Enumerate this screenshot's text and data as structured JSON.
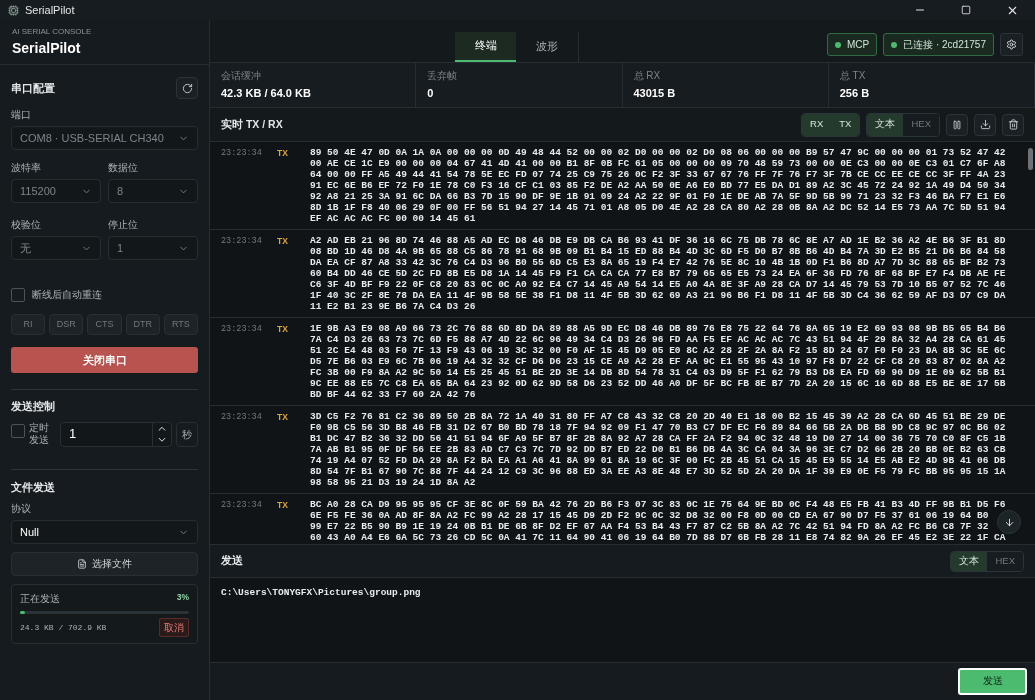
{
  "window": {
    "title": "SerialPilot"
  },
  "sidebar": {
    "subtitle": "AI SERIAL CONSOLE",
    "title": "SerialPilot",
    "port_config": {
      "heading": "串口配置",
      "port": {
        "label": "端口",
        "value": "COM8 · USB-SERIAL CH340",
        "disabled": true
      },
      "fields": [
        {
          "label": "波特率",
          "value": "115200",
          "disabled": true
        },
        {
          "label": "数据位",
          "value": "8",
          "disabled": true
        },
        {
          "label": "校验位",
          "value": "无",
          "disabled": true
        },
        {
          "label": "停止位",
          "value": "1",
          "disabled": true
        }
      ],
      "auto_reconnect": {
        "label": "断线后自动重连",
        "checked": false
      },
      "signals": [
        {
          "label": "RI",
          "on": false
        },
        {
          "label": "DSR",
          "on": false
        },
        {
          "label": "CTS",
          "on": false
        },
        {
          "label": "DTR",
          "on": false
        },
        {
          "label": "RTS",
          "on": false
        }
      ],
      "close_button": "关闭串口"
    },
    "send_control": {
      "heading": "发送控制",
      "timed": {
        "label": "定时发送",
        "checked": false
      },
      "interval": "1",
      "unit": "秒"
    },
    "file_send": {
      "heading": "文件发送",
      "protocol": {
        "label": "协议",
        "value": "Null"
      },
      "choose_button": "选择文件",
      "progress": {
        "label": "正在发送",
        "percent": "3%",
        "level": 0.03,
        "size": "24.3 KB / 702.9 KB",
        "cancel": "取消"
      }
    }
  },
  "tabs": [
    {
      "label": "终端",
      "selected": true
    },
    {
      "label": "波形",
      "selected": false
    }
  ],
  "badges": [
    {
      "label": "MCP"
    },
    {
      "label": "已连接 · 2cd21757"
    }
  ],
  "stats": [
    {
      "label": "会话缓冲",
      "value": "42.3 KB / 64.0 KB"
    },
    {
      "label": "丢弃帧",
      "value": "0"
    },
    {
      "label": "总 RX",
      "value": "43015 B"
    },
    {
      "label": "总 TX",
      "value": "256 B"
    }
  ],
  "log": {
    "title": "实时 TX / RX",
    "filters": [
      {
        "label": "RX",
        "on": true
      },
      {
        "label": "TX",
        "on": true
      }
    ],
    "modes": [
      {
        "label": "文本",
        "selected": true
      },
      {
        "label": "HEX",
        "selected": false
      }
    ],
    "entries": [
      {
        "time": "23:23:34",
        "direction": "TX",
        "lines": [
          "89 50 4E 47 0D 0A 1A 0A 00 00 00 0D 49 48 44 52 00 00 02 D0 00 00 02 D0 08 06 00 00 00 B9 57 47 9C 00 00 00 01 73 52 47 42",
          "00 AE CE 1C E9 00 00 00 04 67 41 4D 41 00 00 B1 8F 0B FC 61 05 00 00 00 09 70 48 59 73 00 00 0E C3 00 00 0E C3 01 C7 6F A8",
          "64 00 00 FF A5 49 44 41 54 78 5E EC FD 07 74 25 C9 75 26 0C F2 3F 33 67 67 76 FF 7F 76 F7 3F 7B CE CC EE CE CC 3F FF 4A 23",
          "91 EC 6E B6 EF 72 F0 1E 78 C0 F3 16 CF C1 03 85 F2 DE A2 AA 50 0E A6 E0 BD 77 E5 DA D1 89 A2 3C 45 72 24 92 1A 49 D4 50 34",
          "92 A8 21 25 3A 91 6C DA 66 B3 7D 15 90 DF 9E 1B 91 09 24 A2 22 9F 01 F0 1E DE AB 7A 5F 9D 5B 99 71 23 32 F3 46 BA F7 E1 E6",
          "8D 1B 1F F8 40 06 29 0F 00 FF 56 51 94 27 14 45 71 01 A8 05 D0 4E A2 28 CA 80 A2 28 0B 8A A2 DC 52 14 E5 73 AA 7C 5D 51 94",
          "EF AC AC AC FC 00 00 14 45 61"
        ]
      },
      {
        "time": "23:23:34",
        "direction": "TX",
        "lines": [
          "A2 AD EB 21 96 8D 74 46 88 A5 AD EC D8 46 DB E9 DB CA B6 93 41 DF 36 16 6C 75 DB 78 6C 8E A7 AD 1E B2 36 A2 4E B6 3F B1 8D",
          "08 BD 1D 46 D8 4A 9B 65 88 C5 86 78 91 68 9B 09 B1 B4 15 ED 88 B4 4D 3C 6D F5 D0 B7 8B B6 4D B4 7A 3D E2 B5 21 D6 B6 84 58",
          "DA EA CF 87 A8 33 42 3C 76 C4 D3 96 B0 55 6D C5 E3 8A 65 19 F4 E7 42 76 5E 8C 10 4B 1B 0D F1 B6 8D A7 7D 3C 88 65 BF B2 73",
          "60 B4 DD 46 CE 5D 2C FD 8B E5 D8 1A 14 45 F9 F1 CA CA CA 77 E8 B7 79 65 65 E5 73 24 EA 6F 36 FD 76 8F 68 BF E7 F4 DB AE FE",
          "C6 3F 4D BF F9 22 0F C8 20 83 0C 0C A0 92 E4 C7 14 45 A9 54 14 E5 A0 4A 8E 3F A9 28 CA D7 14 45 79 53 7D 10 B5 07 52 7C 46",
          "1F 40 3C 2F 8E 78 DA EA 11 4F 9B 58 5E 38 F1 D8 11 4F 5B 3D 62 69 A3 21 96 B6 F1 D8 11 4F 5B 3D C4 36 62 59 AF D3 D7 C9 DA",
          "11 E2 B1 23 9E B6 7A C4 D3 26"
        ]
      },
      {
        "time": "23:23:34",
        "direction": "TX",
        "lines": [
          "1E 9B A3 E9 08 A9 66 73 2C 76 88 6D 8D DA 89 88 A5 9D EC D8 46 DB 89 76 E8 75 22 64 76 8A 65 19 E2 69 93 08 9B B5 65 B4 B6",
          "7A C4 D3 26 63 73 7C 6D F5 88 A7 4D 22 6C 96 49 34 C4 D3 26 96 FD AA F5 EF AC AC AC 7C 43 51 94 4F 29 8A 32 A4 28 CA 61 45",
          "51 2C E4 48 03 F0 7F 13 F9 43 06 19 3C 32 00 F0 AF 15 45 D9 05 E0 8C A2 28 2F 2A 8A F2 15 8D 24 67 F0 F0 23 DA 8B 3C 5E 6C",
          "D5 7E B6 03 E9 6C 7B 06 19 A4 32 32 CF D6 D6 23 15 CE A9 A2 28 EF AA 9C E1 55 95 43 10 97 F8 D7 22 CF C8 20 83 87 02 8A A2",
          "FC 3B 00 F9 8A A2 9C 50 14 E5 25 45 51 BE 2D 3E 14 DB 8D 54 78 31 C4 03 D9 5F F1 62 79 B3 D8 EA FD 69 90 D9 1E 09 62 5B B1",
          "9C EE 88 E5 7C C8 EA 65 BA 64 23 92 0D 62 9D 58 D6 23 52 DD 46 A0 DF 5F BC FB 8E B7 7D 2A 20 15 6C 16 6D 88 E5 BE 8E 17 5B",
          "BD BF 44 62 33 F7 60 2A 42 76"
        ]
      },
      {
        "time": "23:23:34",
        "direction": "TX",
        "lines": [
          "3D C5 F2 76 81 C2 36 89 50 2B 8A 72 1A 40 31 80 FF A7 C8 43 32 C8 20 2D 40 E1 18 00 B2 15 45 39 A2 28 CA 6D 45 51 BE 29 DE",
          "F0 9B C5 56 3D B8 46 FB 31 D2 67 B0 BD 78 18 7F 94 92 09 F1 47 70 B3 C7 DF EC F6 89 84 66 5B 2A DB B8 9D C8 9C 97 0C B6 02",
          "B1 DC 47 B2 36 32 DD 56 41 51 94 6F A9 5F B7 8F 2B 8A 92 A7 28 CA FF 2A F2 94 0C 32 48 19 D0 27 14 00 36 75 70 C0 8F C5 1B",
          "7A AB B1 95 0F DF 56 EE 2B 83 AD C7 C3 7C 7D 92 DD B7 ED 22 D0 B1 B6 DB 4A 3C CA 04 3A 96 3E C7 D2 66 2B 20 BB 0E B2 63 CB",
          "74 19 A4 07 52 FD DA 29 8A F2 BA EA A1 A6 41 8A 99 01 8A 19 6C 3F 00 FC 2B 45 51 CA 15 45 E9 55 14 E5 AB E2 4D 9B 41 06 DB",
          "8D 54 7F B1 67 90 7C 88 7F 44 24 12 C9 3C 96 88 ED 3A EE A3 8E 48 E7 3D 52 5D 2A 20 DA 1F 39 E9 0E F5 79 FC BB 95 95 15 1A",
          "98 58 95 21 D3 19 24 1D 8A A2"
        ]
      },
      {
        "time": "23:23:34",
        "direction": "TX",
        "lines": [
          "BC A0 28 CA D9 95 95 95 CF 3E 8C 0F 59 BA 42 76 2D B6 F3 07 3C 83 0C 1E 75 64 9E BD 0C F4 48 E5 FB 41 B3 4D FF 9B B1 D5 F6",
          "6E F5 FE 36 0A AD 8F 8A A2 FC 99 A2 28 17 15 45 D9 2D F2 9C 0C 32 D8 32 00 F8 0D 00 CD EA 67 90 D7 F5 37 61 06 19 64 B0",
          "99 E7 22 B5 90 B9 1E 19 24 0B B1 DE 6B 8F D2 EF 67 AA F4 53 B4 43 F7 87 C2 5B 8A A2 7C 42 51 94 FD 8A A2 FC B6 C8 7F 32",
          "60 43 A0 A4 E6 6A 5C 73 26 CD 5C 0A 41 7C 11 64 90 41 06 19 64 B0 7D 88 D7 6B FB 28 11 E8 74 82 9A 26 EF 45 E2 3E 22 1F CA"
        ]
      }
    ]
  },
  "send": {
    "title": "发送",
    "modes": [
      {
        "label": "文本",
        "selected": true
      },
      {
        "label": "HEX",
        "selected": false
      }
    ],
    "value": "C:\\Users\\TONYGFX\\Pictures\\group.png",
    "button": "发送"
  }
}
